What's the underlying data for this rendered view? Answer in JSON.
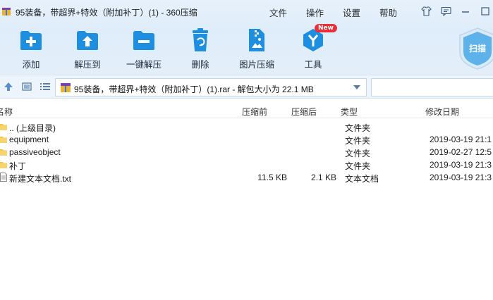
{
  "window": {
    "title": "95装备，带超界+特效（附加补丁）(1) - 360压缩",
    "menu": [
      "文件",
      "操作",
      "设置",
      "帮助"
    ]
  },
  "toolbar": {
    "items": [
      {
        "label": "添加",
        "icon": "add-icon"
      },
      {
        "label": "解压到",
        "icon": "extract-to-icon"
      },
      {
        "label": "一键解压",
        "icon": "one-click-extract-icon"
      },
      {
        "label": "删除",
        "icon": "delete-icon"
      },
      {
        "label": "图片压缩",
        "icon": "image-compress-icon"
      },
      {
        "label": "工具",
        "icon": "tools-icon"
      }
    ],
    "new_badge": "New",
    "scan_label": "扫描"
  },
  "address": {
    "text": "95装备，带超界+特效（附加补丁）(1).rar - 解包大小为 22.1 MB"
  },
  "columns": {
    "name": "名称",
    "size": "压缩前",
    "compressed": "压缩后",
    "type": "类型",
    "modified": "修改日期"
  },
  "files": [
    {
      "name": ".. (上级目录)",
      "size": "",
      "compressed": "",
      "type": "文件夹",
      "modified": "",
      "kind": "folder"
    },
    {
      "name": "equipment",
      "size": "",
      "compressed": "",
      "type": "文件夹",
      "modified": "2019-03-19 21:1",
      "kind": "folder"
    },
    {
      "name": "passiveobject",
      "size": "",
      "compressed": "",
      "type": "文件夹",
      "modified": "2019-02-27 12:5",
      "kind": "folder"
    },
    {
      "name": "补丁",
      "size": "",
      "compressed": "",
      "type": "文件夹",
      "modified": "2019-03-19 21:3",
      "kind": "folder"
    },
    {
      "name": "新建文本文档.txt",
      "size": "11.5 KB",
      "compressed": "2.1 KB",
      "type": "文本文档",
      "modified": "2019-03-19 21:3",
      "kind": "file"
    }
  ],
  "colors": {
    "accent": "#1e8fe0",
    "folder": "#f5c646",
    "new_badge": "#e8303a"
  }
}
